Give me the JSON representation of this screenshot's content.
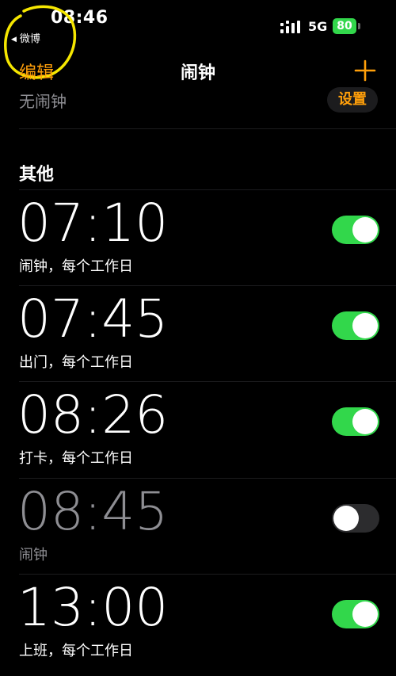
{
  "status_bar": {
    "time": "08:46",
    "back_app": "微博",
    "network": "5G",
    "battery": "80"
  },
  "nav": {
    "edit_label": "编辑",
    "title": "闹钟",
    "add_icon": "plus-icon"
  },
  "sleep": {
    "no_alarm_label": "无闹钟",
    "setup_label": "设置"
  },
  "section_header": "其他",
  "alarms": [
    {
      "time": "07:10",
      "label": "闹钟，每个工作日",
      "enabled": true
    },
    {
      "time": "07:45",
      "label": "出门，每个工作日",
      "enabled": true
    },
    {
      "time": "08:26",
      "label": "打卡，每个工作日",
      "enabled": true
    },
    {
      "time": "08:45",
      "label": "闹钟",
      "enabled": false
    },
    {
      "time": "13:00",
      "label": "上班，每个工作日",
      "enabled": true
    }
  ],
  "colors": {
    "accent": "#ff9f0a",
    "toggle_on": "#32d74b",
    "toggle_off": "#2c2c2e",
    "secondary_text": "#8e8e93",
    "annotation": "#f5e600"
  }
}
